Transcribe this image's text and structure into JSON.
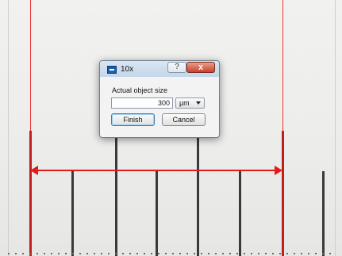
{
  "dialog": {
    "title": "10x",
    "help_label": "?",
    "close_label": "x",
    "field_label": "Actual object size",
    "size_value": "300",
    "unit_selected": "µm",
    "finish_label": "Finish",
    "cancel_label": "Cancel"
  },
  "colors": {
    "measurement": "#e21b1b",
    "tick": "#3a3a3a"
  },
  "icons": {
    "app": "app-window-icon",
    "caret": "chevron-down-icon"
  }
}
